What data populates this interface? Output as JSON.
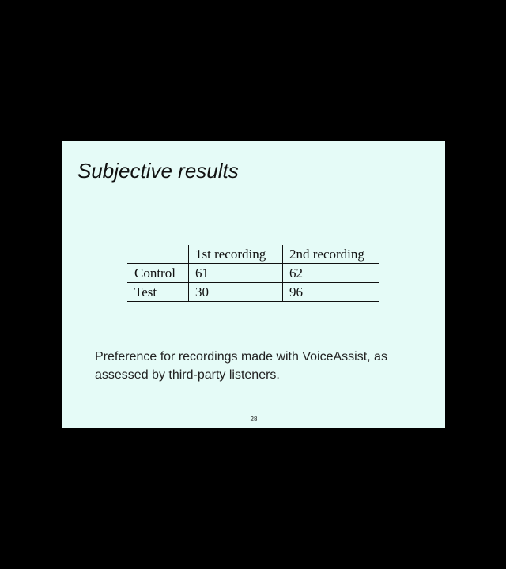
{
  "slide": {
    "title": "Subjective results",
    "table": {
      "columns": [
        "",
        "1st recording",
        "2nd recording"
      ],
      "rows": [
        {
          "label": "Control",
          "values": [
            "61",
            "62"
          ]
        },
        {
          "label": "Test",
          "values": [
            "30",
            "96"
          ]
        }
      ]
    },
    "caption": "Preference for recordings made with VoiceAssist, as assessed by third-party listeners.",
    "page_number": "28"
  },
  "colors": {
    "background": "#000000",
    "slide_background": "#e5fbf7",
    "text": "#111111"
  }
}
